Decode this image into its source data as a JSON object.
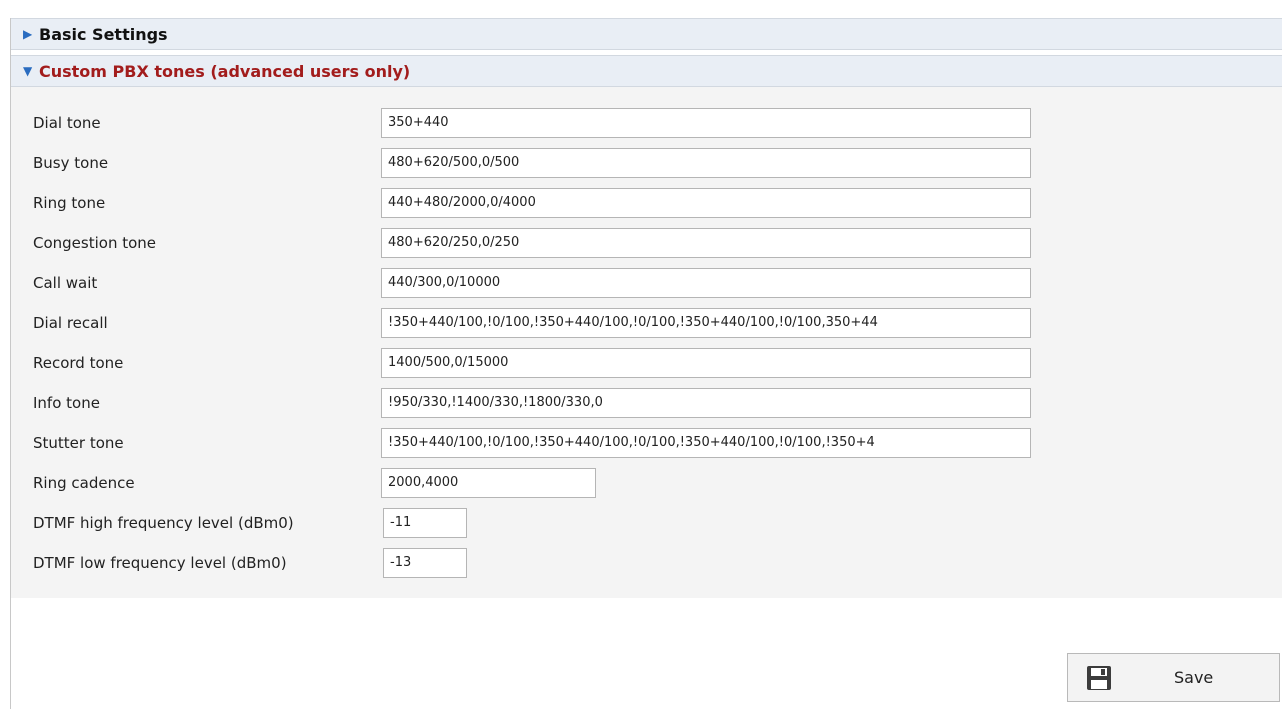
{
  "sections": {
    "basic": {
      "title": "Basic Settings",
      "icon": "triangle-right-icon"
    },
    "custom": {
      "title": "Custom PBX tones (advanced users only)",
      "icon": "triangle-down-icon"
    }
  },
  "fields": {
    "dial_tone": {
      "label": "Dial tone",
      "value": "350+440"
    },
    "busy_tone": {
      "label": "Busy tone",
      "value": "480+620/500,0/500"
    },
    "ring_tone": {
      "label": "Ring tone",
      "value": "440+480/2000,0/4000"
    },
    "congestion_tone": {
      "label": "Congestion tone",
      "value": "480+620/250,0/250"
    },
    "call_wait": {
      "label": "Call wait",
      "value": "440/300,0/10000"
    },
    "dial_recall": {
      "label": "Dial recall",
      "value": "!350+440/100,!0/100,!350+440/100,!0/100,!350+440/100,!0/100,350+44"
    },
    "record_tone": {
      "label": "Record tone",
      "value": "1400/500,0/15000"
    },
    "info_tone": {
      "label": "Info tone",
      "value": "!950/330,!1400/330,!1800/330,0"
    },
    "stutter_tone": {
      "label": "Stutter tone",
      "value": "!350+440/100,!0/100,!350+440/100,!0/100,!350+440/100,!0/100,!350+4"
    },
    "ring_cadence": {
      "label": "Ring cadence",
      "value": "2000,4000"
    },
    "dtmf_high": {
      "label": "DTMF high frequency level (dBm0)",
      "value": "-11"
    },
    "dtmf_low": {
      "label": "DTMF low frequency level (dBm0)",
      "value": "-13"
    }
  },
  "save": {
    "label": "Save",
    "icon": "floppy-disk-icon"
  },
  "colors": {
    "header_bg": "#e9eef5",
    "active_header": "#a21c1c",
    "accent": "#2a6cc0",
    "panel_bg": "#f4f4f4"
  }
}
